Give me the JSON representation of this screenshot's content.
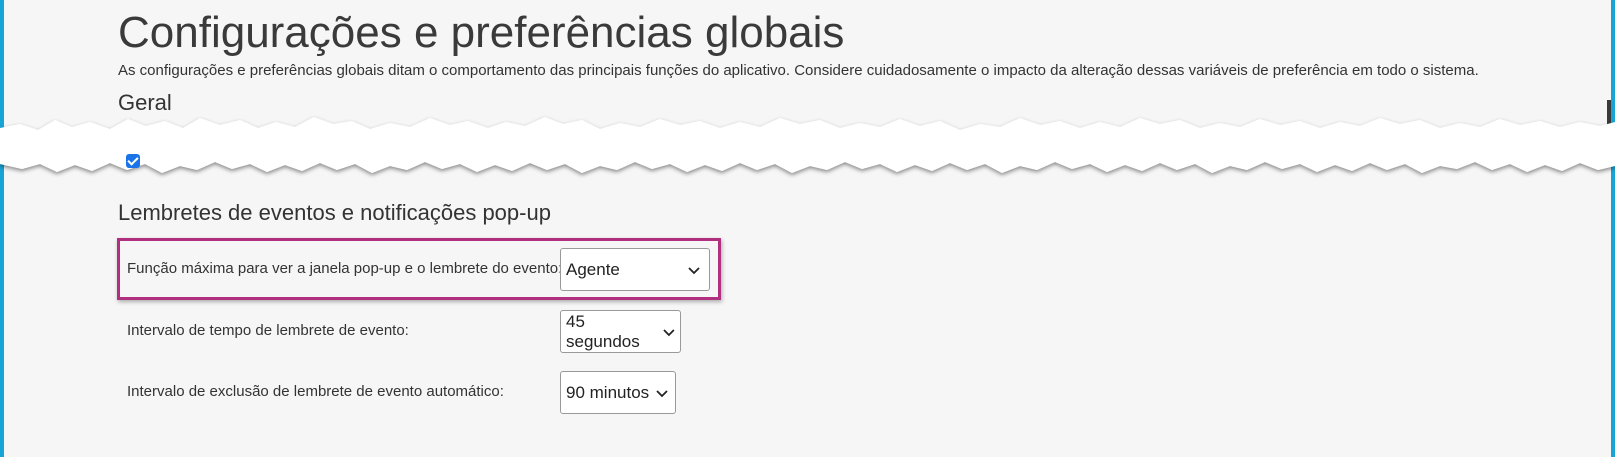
{
  "page": {
    "title": "Configurações e preferências globais",
    "description": "As configurações e preferências globais ditam o comportamento das principais funções do aplicativo. Considere cuidadosamente o impacto da alteração dessas variáveis de preferência em todo o sistema."
  },
  "sections": {
    "general": {
      "heading": "Geral"
    },
    "reminders": {
      "heading": "Lembretes de eventos e notificações pop-up",
      "rows": [
        {
          "label": "Função máxima para ver a janela pop-up e o lembrete do evento:",
          "value": "Agente"
        },
        {
          "label": "Intervalo de tempo de lembrete de evento:",
          "value": "45 segundos"
        },
        {
          "label": "Intervalo de exclusão de lembrete de evento automático:",
          "value": "90 minutos"
        }
      ]
    }
  },
  "colors": {
    "highlight": "#b0307f",
    "edge": "#19a4d6",
    "checkbox": "#1a73e8"
  },
  "icons": {
    "dropdown": "chevron-down-icon"
  }
}
